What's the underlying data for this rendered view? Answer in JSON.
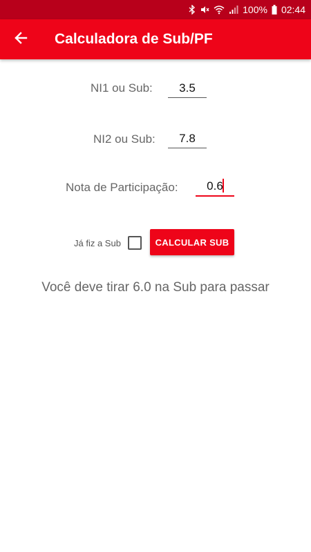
{
  "status_bar": {
    "battery": "100%",
    "time": "02:44",
    "icons": [
      "bluetooth-icon",
      "mute-icon",
      "wifi-icon",
      "signal-icon",
      "battery-icon"
    ]
  },
  "app_bar": {
    "title": "Calculadora de Sub/PF",
    "back_icon": "arrow-left-icon"
  },
  "form": {
    "ni1": {
      "label": "NI1 ou Sub:",
      "value": "3.5"
    },
    "ni2": {
      "label": "NI2 ou Sub:",
      "value": "7.8"
    },
    "participacao": {
      "label": "Nota de Participação:",
      "value": "0.6"
    }
  },
  "actions": {
    "checkbox_label": "Já fiz a Sub",
    "checkbox_checked": false,
    "calculate_label": "CALCULAR SUB"
  },
  "result": {
    "text": "Você deve tirar 6.0 na Sub para passar"
  },
  "colors": {
    "status_bar": "#b8001b",
    "app_bar": "#ee0419",
    "accent": "#ee0419",
    "label_text": "#666666"
  }
}
